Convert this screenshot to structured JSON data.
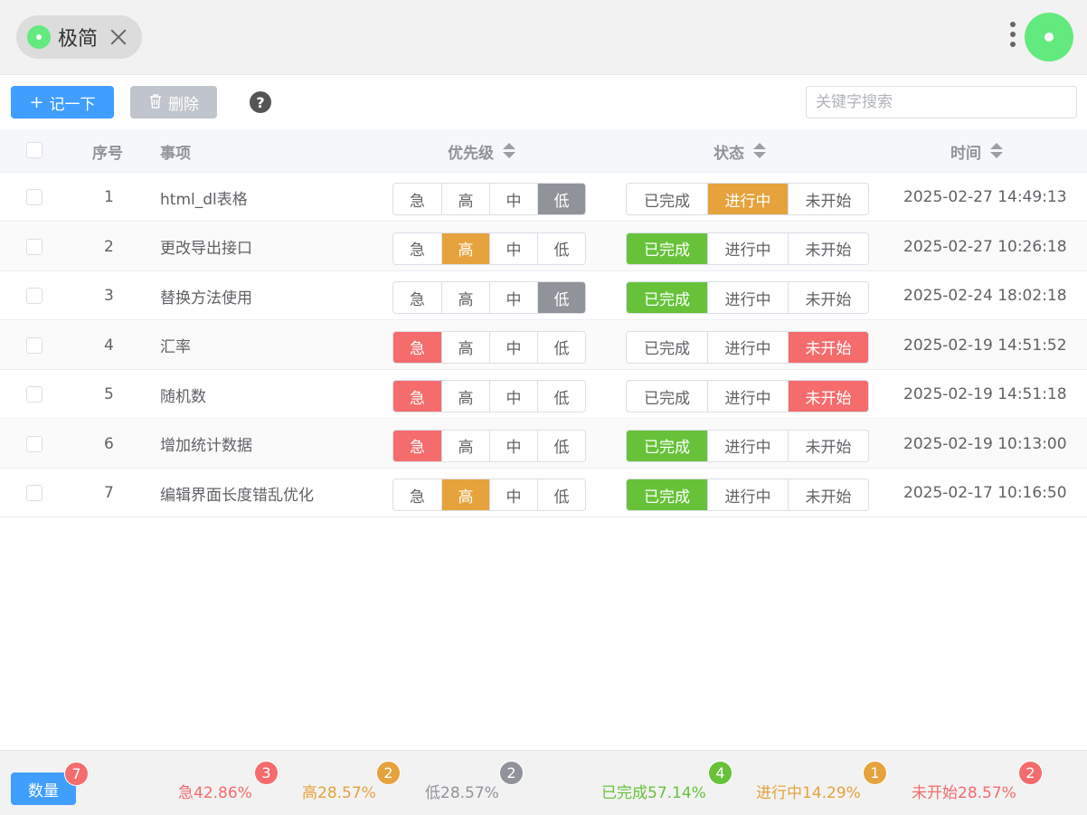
{
  "header": {
    "tab_label": "极简"
  },
  "toolbar": {
    "add_label": "记一下",
    "delete_label": "删除",
    "help": "?",
    "search_placeholder": "关键字搜索"
  },
  "table": {
    "headers": {
      "index": "序号",
      "item": "事项",
      "priority": "优先级",
      "status": "状态",
      "time": "时间"
    },
    "priority_options": [
      "急",
      "高",
      "中",
      "低"
    ],
    "status_options": [
      "已完成",
      "进行中",
      "未开始"
    ],
    "rows": [
      {
        "index": "1",
        "item": "html_dl表格",
        "priority": "低",
        "status": "进行中",
        "time": "2025-02-27 14:49:13"
      },
      {
        "index": "2",
        "item": "更改导出接口",
        "priority": "高",
        "status": "已完成",
        "time": "2025-02-27 10:26:18"
      },
      {
        "index": "3",
        "item": "替换方法使用",
        "priority": "低",
        "status": "已完成",
        "time": "2025-02-24 18:02:18"
      },
      {
        "index": "4",
        "item": "汇率",
        "priority": "急",
        "status": "未开始",
        "time": "2025-02-19 14:51:52"
      },
      {
        "index": "5",
        "item": "随机数",
        "priority": "急",
        "status": "未开始",
        "time": "2025-02-19 14:51:18"
      },
      {
        "index": "6",
        "item": "增加统计数据",
        "priority": "急",
        "status": "已完成",
        "time": "2025-02-19 10:13:00"
      },
      {
        "index": "7",
        "item": "编辑界面长度错乱优化",
        "priority": "高",
        "status": "已完成",
        "time": "2025-02-17 10:16:50"
      }
    ]
  },
  "footer": {
    "count_label": "数量",
    "count_badge": "7",
    "stats": [
      {
        "label": "急42.86%",
        "badge": "3",
        "color": "#f56c6c"
      },
      {
        "label": "高28.57%",
        "badge": "2",
        "color": "#e6a23c"
      },
      {
        "label": "低28.57%",
        "badge": "2",
        "color": "#909399"
      },
      {
        "label": "已完成57.14%",
        "badge": "4",
        "color": "#67c23a"
      },
      {
        "label": "进行中14.29%",
        "badge": "1",
        "color": "#e6a23c"
      },
      {
        "label": "未开始28.57%",
        "badge": "2",
        "color": "#f56c6c"
      }
    ]
  },
  "colors": {
    "primary": "#409eff",
    "urgent": "#f56c6c",
    "high": "#e6a23c",
    "low": "#909399",
    "done": "#67c23a",
    "doing": "#e6a23c",
    "todo": "#f56c6c",
    "avatar": "#63ea7e"
  }
}
